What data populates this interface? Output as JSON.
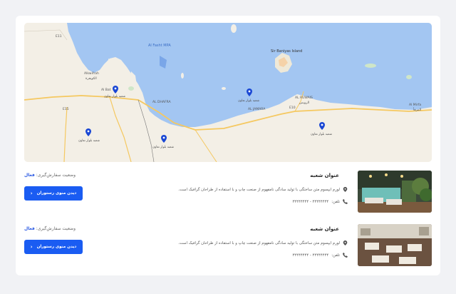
{
  "map": {
    "labels": {
      "al_fasht": "Al Fasht MPA",
      "sir_baniyas": "Sir Baniyas Island",
      "alkwifrah": "Alkwifrah",
      "alkwifrah_ar": "الكويفرة",
      "al_ruwais": "AL RUWAIS",
      "al_ruwais_ar": "الرويس",
      "al_mirfa": "Al Mirfa",
      "al_mirfa_ar": "المرفأ",
      "al_dhafra": "AL DHAFRA",
      "al_jamara": "AL JAMARA",
      "road_e11": "E11",
      "road_e15": "E15",
      "road_e10": "E10",
      "al_batin": "Al Bat",
      "branch_label": "شعبه بلوار تعاون"
    }
  },
  "branches": [
    {
      "title": "عنوان شعبه",
      "description": "لورم ایپسوم متن ساختگی با تولید سادگی نامفهوم از صنعت چاپ و با استفاده از طراحان گرافیک است.",
      "phone_label": "تلفن:",
      "phone": "۴۴۴۴۴۴۴۴ - ۴۴۴۴۴۴۴۴",
      "status_label": "وضعیت سفارش‌گیری:",
      "status_value": "فعال",
      "button_label": "دیدن منوی رستوران"
    },
    {
      "title": "عنوان شعبه",
      "description": "لورم ایپسوم متن ساختگی با تولید سادگی نامفهوم از صنعت چاپ و با استفاده از طراحان گرافیک است.",
      "phone_label": "تلفن:",
      "phone": "۴۴۴۴۴۴۴۴ - ۴۴۴۴۴۴۴۴",
      "status_label": "وضعیت سفارش‌گیری:",
      "status_value": "فعال",
      "button_label": "دیدن منوی رستوران"
    }
  ],
  "colors": {
    "primary": "#1a5cf2",
    "status_active": "#2d5be3",
    "water": "#a3c6f2",
    "land": "#f3efe6",
    "pin": "#1a47d4"
  }
}
